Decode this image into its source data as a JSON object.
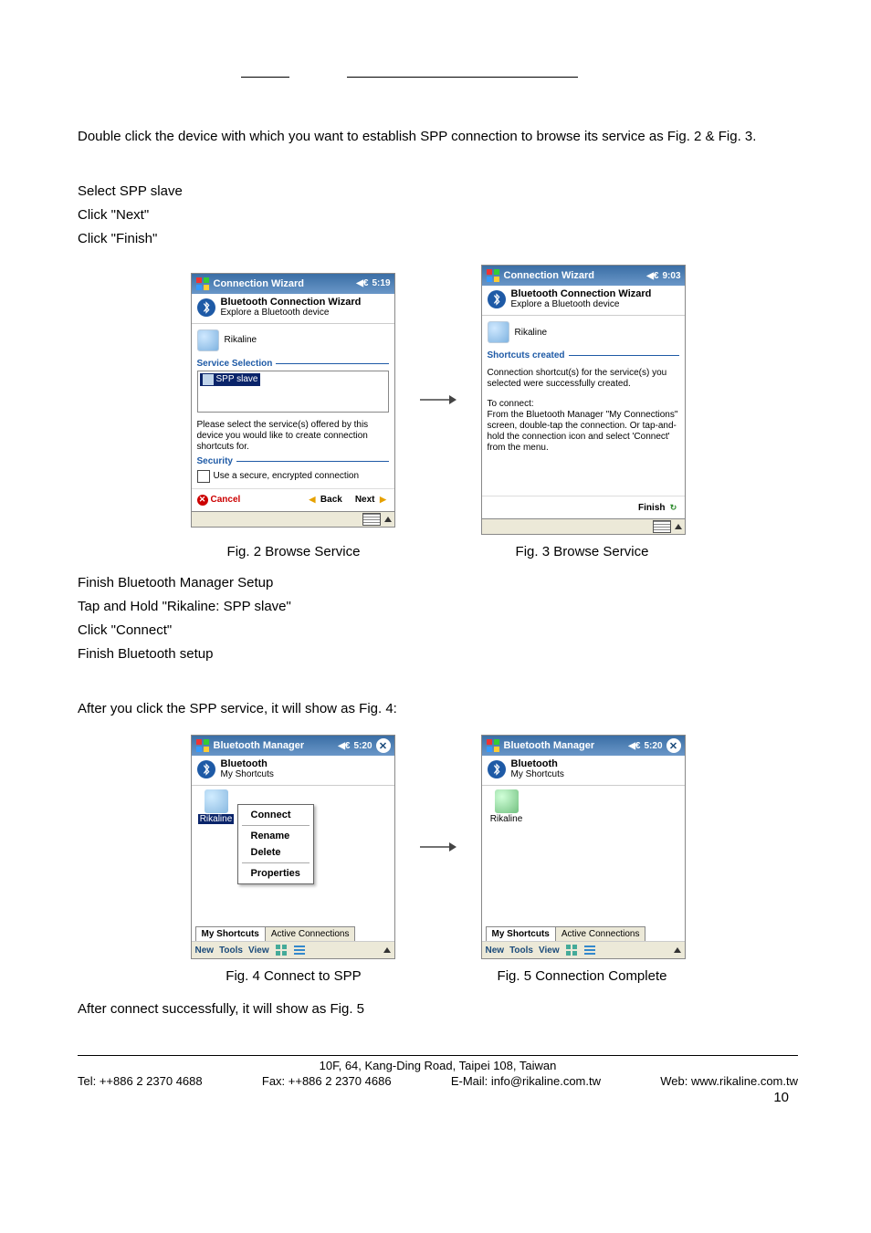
{
  "page_number": "10",
  "intro_paragraph": "Double click the device with which you want to establish SPP connection to browse its service as Fig. 2 & Fig. 3.",
  "steps_a": [
    "Select SPP slave",
    "Click \"Next\"",
    "Click \"Finish\""
  ],
  "fig2": {
    "caption": "Fig. 2      Browse Service",
    "titlebar": "Connection Wizard",
    "time": "5:19",
    "sub_title": "Bluetooth Connection Wizard",
    "sub_desc": "Explore a Bluetooth device",
    "device_name": "Rikaline",
    "group_service": "Service Selection",
    "service_item": "SPP slave",
    "hint": "Please select the service(s) offered by this device you would like to create connection shortcuts for.",
    "group_security": "Security",
    "checkbox_label": "Use a secure, encrypted connection",
    "btn_cancel": "Cancel",
    "btn_back": "Back",
    "btn_next": "Next"
  },
  "fig3": {
    "caption": "Fig. 3      Browse Service",
    "titlebar": "Connection Wizard",
    "time": "9:03",
    "sub_title": "Bluetooth Connection Wizard",
    "sub_desc": "Explore a Bluetooth device",
    "device_name": "Rikaline",
    "group_label": "Shortcuts created",
    "msg1": "Connection shortcut(s) for the service(s) you selected were successfully created.",
    "msg2": "To connect:\nFrom the Bluetooth Manager \"My Connections\" screen, double-tap the connection. Or tap-and-hold the connection icon and select 'Connect' from the menu.",
    "btn_finish": "Finish"
  },
  "steps_b": [
    "Finish Bluetooth Manager Setup",
    "Tap and Hold \"Rikaline: SPP slave\"",
    "Click \"Connect\"",
    "Finish Bluetooth setup"
  ],
  "mid_paragraph": "After you click the SPP service, it will show as Fig. 4:",
  "fig4": {
    "caption": "Fig. 4      Connect to SPP",
    "titlebar": "Bluetooth Manager",
    "time": "5:20",
    "sub_title": "Bluetooth",
    "sub_desc": "My Shortcuts",
    "icon_label": "Rikaline",
    "ctx": [
      "Connect",
      "Rename",
      "Delete",
      "Properties"
    ],
    "tabs": [
      "My Shortcuts",
      "Active Connections"
    ],
    "menubar": [
      "New",
      "Tools",
      "View"
    ]
  },
  "fig5": {
    "caption": "Fig. 5 Connection Complete",
    "titlebar": "Bluetooth Manager",
    "time": "5:20",
    "sub_title": "Bluetooth",
    "sub_desc": "My Shortcuts",
    "icon_label": "Rikaline",
    "tabs": [
      "My Shortcuts",
      "Active Connections"
    ],
    "menubar": [
      "New",
      "Tools",
      "View"
    ]
  },
  "end_paragraph": "After connect successfully, it will show as Fig. 5",
  "footer": {
    "address": "10F, 64, Kang-Ding Road, Taipei 108, Taiwan",
    "tel": "Tel: ++886 2 2370 4688",
    "fax": "Fax: ++886 2 2370 4686",
    "email": "E-Mail: info@rikaline.com.tw",
    "web": "Web: www.rikaline.com.tw"
  }
}
